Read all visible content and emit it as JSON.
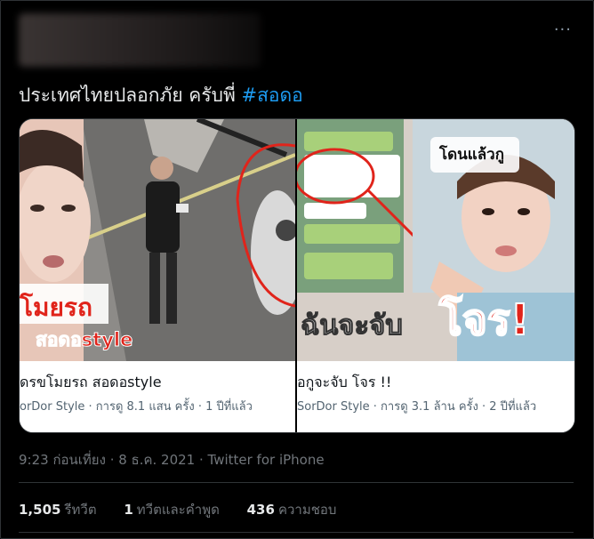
{
  "tweet": {
    "text": "ประเทศไทยปลอกภัย ครับพี่ ",
    "hashtag": "#สอดอ",
    "more_icon": "more-dots-icon",
    "timestamp": "9:23 ก่อนเที่ยง · 8 ธ.ค. 2021 · Twitter for iPhone"
  },
  "cards": [
    {
      "title": "ดรขโมยรถ สอดอstyle",
      "meta": "orDor Style · การดู 8.1 แสน ครั้ง · 1 ปีที่แล้ว",
      "overlay_text_1": "โมยรถ",
      "overlay_text_2": "สอดอstyle"
    },
    {
      "title": "อกูจะจับ โจร !!",
      "meta": "SorDor Style · การดู 3.1 ล้าน ครั้ง · 2 ปีที่แล้ว",
      "overlay_text_1": "ฉันจะจับ",
      "overlay_text_2": "โจร!",
      "overlay_text_3": "โดนแล้วกู"
    }
  ],
  "stats": {
    "retweets_count": "1,505",
    "retweets_label": "รีทวีต",
    "quotes_count": "1",
    "quotes_label": "ทวีตและคำพูด",
    "likes_count": "436",
    "likes_label": "ความชอบ"
  },
  "colors": {
    "background": "#000000",
    "hashtag": "#1d9bf0",
    "overlay_red": "#e0241b"
  }
}
